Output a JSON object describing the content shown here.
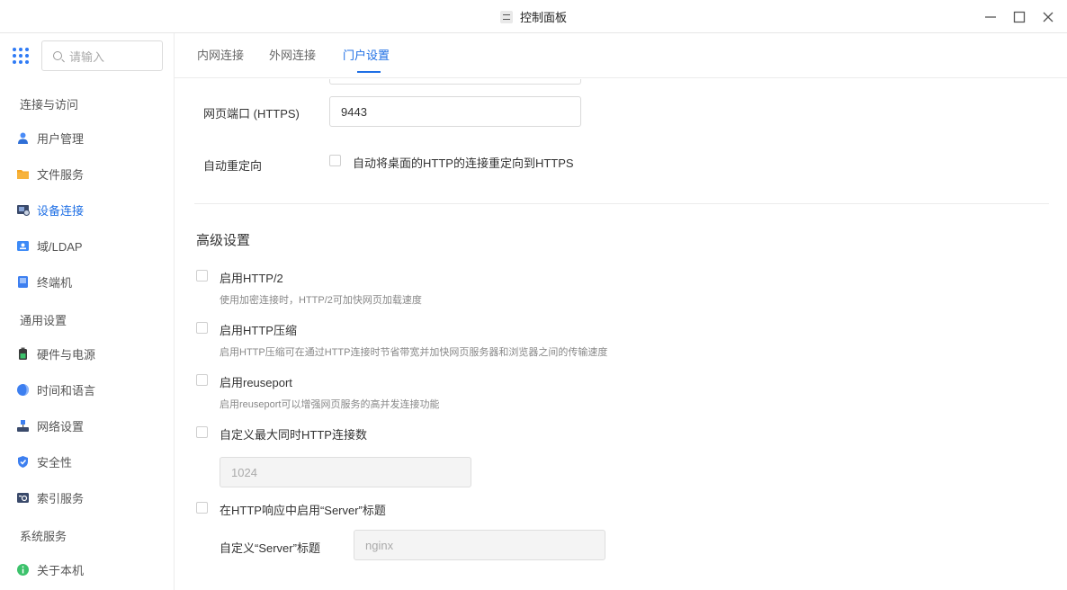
{
  "window": {
    "title": "控制面板",
    "controls": {
      "minimize": "minimize-icon",
      "maximize": "maximize-icon",
      "close": "close-icon"
    }
  },
  "search": {
    "placeholder": "请输入"
  },
  "sidebar": {
    "sections": [
      {
        "label": "连接与访问",
        "items": [
          {
            "label": "用户管理",
            "icon": "user-icon",
            "active": false
          },
          {
            "label": "文件服务",
            "icon": "folder-icon",
            "active": false
          },
          {
            "label": "设备连接",
            "icon": "device-icon",
            "active": true
          },
          {
            "label": "域/LDAP",
            "icon": "ldap-icon",
            "active": false
          },
          {
            "label": "终端机",
            "icon": "terminal-icon",
            "active": false
          }
        ]
      },
      {
        "label": "通用设置",
        "items": [
          {
            "label": "硬件与电源",
            "icon": "battery-icon",
            "active": false
          },
          {
            "label": "时间和语言",
            "icon": "globe-icon",
            "active": false
          },
          {
            "label": "网络设置",
            "icon": "network-icon",
            "active": false
          },
          {
            "label": "安全性",
            "icon": "shield-icon",
            "active": false
          },
          {
            "label": "索引服务",
            "icon": "index-icon",
            "active": false
          }
        ]
      },
      {
        "label": "系统服务",
        "items": [
          {
            "label": "关于本机",
            "icon": "info-icon",
            "active": false
          }
        ]
      }
    ]
  },
  "tabs": [
    {
      "label": "内网连接",
      "active": false
    },
    {
      "label": "外网连接",
      "active": false
    },
    {
      "label": "门户设置",
      "active": true
    }
  ],
  "portal": {
    "https_port_label": "网页端口 (HTTPS)",
    "https_port_value": "9443",
    "redirect_label": "自动重定向",
    "redirect_checkbox_label": "自动将桌面的HTTP的连接重定向到HTTPS"
  },
  "advanced": {
    "title": "高级设置",
    "http2": {
      "label": "启用HTTP/2",
      "desc": "使用加密连接时，HTTP/2可加快网页加载速度"
    },
    "compression": {
      "label": "启用HTTP压缩",
      "desc": "启用HTTP压缩可在通过HTTP连接时节省带宽并加快网页服务器和浏览器之间的传输速度"
    },
    "reuseport": {
      "label": "启用reuseport",
      "desc": "启用reuseport可以增强网页服务的高并发连接功能"
    },
    "max_conn": {
      "label": "自定义最大同时HTTP连接数",
      "value": "1024"
    },
    "server_header": {
      "label": "在HTTP响应中启用“Server”标题",
      "custom_label": "自定义“Server”标题",
      "custom_value": "nginx"
    }
  },
  "colors": {
    "accent": "#1f6fe5",
    "border": "#d9d9d9",
    "muted_text": "#888888"
  }
}
